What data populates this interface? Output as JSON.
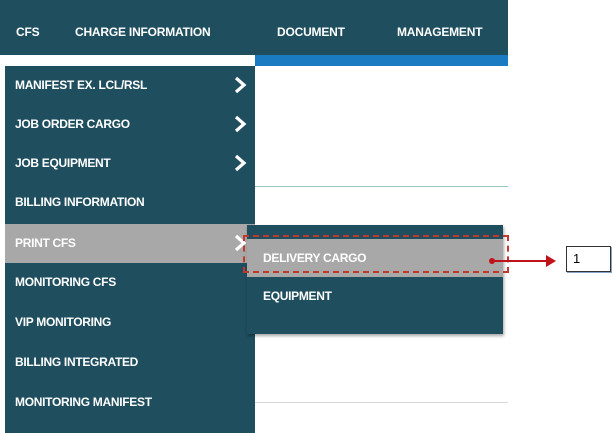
{
  "top_nav": {
    "items": [
      "CFS",
      "CHARGE INFORMATION",
      "DOCUMENT",
      "MANAGEMENT"
    ]
  },
  "menu": {
    "items": [
      {
        "label": "MANIFEST EX. LCL/RSL",
        "has_submenu": true,
        "active": false
      },
      {
        "label": "JOB ORDER CARGO",
        "has_submenu": true,
        "active": false
      },
      {
        "label": "JOB EQUIPMENT",
        "has_submenu": true,
        "active": false
      },
      {
        "label": "BILLING INFORMATION",
        "has_submenu": false,
        "active": false
      },
      {
        "label": "PRINT CFS",
        "has_submenu": true,
        "active": true
      },
      {
        "label": "MONITORING CFS",
        "has_submenu": false,
        "active": false
      },
      {
        "label": "VIP MONITORING",
        "has_submenu": false,
        "active": false
      },
      {
        "label": "BILLING INTEGRATED",
        "has_submenu": false,
        "active": false
      },
      {
        "label": "MONITORING MANIFEST",
        "has_submenu": false,
        "active": false
      }
    ]
  },
  "submenu": {
    "items": [
      {
        "label": "DELIVERY CARGO",
        "highlighted": true
      },
      {
        "label": "EQUIPMENT",
        "highlighted": false
      }
    ]
  },
  "annotation": {
    "callout_label": "1",
    "color": "#c0121b"
  },
  "colors": {
    "nav_bg": "#1f4e5f",
    "accent_blue": "#1a7bc2",
    "active_bg": "#a8a8a8"
  }
}
